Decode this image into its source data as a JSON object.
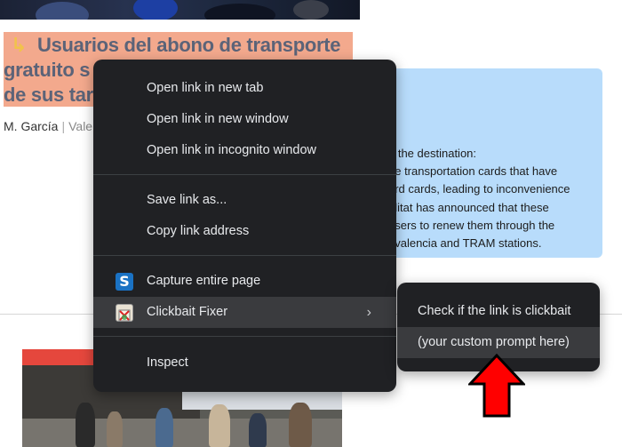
{
  "article": {
    "headline_lines": [
      "Usuarios del abono de transporte",
      "gratuito s",
      "de sus tar"
    ],
    "headline_arrow": "↳",
    "author": "M. García",
    "byline_separator": "|",
    "place": "Vale",
    "summary_lines": [
      "g the destination:",
      "ee transportation cards that have",
      "ard cards, leading to inconvenience",
      "alitat has announced that these",
      " users to renew them through the",
      "ovalencia and TRAM stations."
    ]
  },
  "context_menu": {
    "items": [
      {
        "label": "Open link in new tab"
      },
      {
        "label": "Open link in new window"
      },
      {
        "label": "Open link in incognito window"
      },
      {
        "label": "Save link as..."
      },
      {
        "label": "Copy link address"
      },
      {
        "label": "Capture entire page",
        "icon": "screenshot-extension-icon",
        "icon_glyph": "S"
      },
      {
        "label": "Clickbait Fixer",
        "icon": "clickbait-fixer-icon",
        "submenu_chevron": "›"
      },
      {
        "label": "Inspect"
      }
    ]
  },
  "submenu": {
    "items": [
      {
        "label": "Check if the link is clickbait"
      },
      {
        "label": "(your custom prompt here)"
      }
    ]
  },
  "colors": {
    "menu_bg": "#202124",
    "menu_hover": "#3a3b3e",
    "menu_text": "#e8eaed",
    "headline_highlight": "#f3a98d",
    "summary_bg": "#b8dcfb",
    "annotation_arrow": "#ff0000"
  }
}
